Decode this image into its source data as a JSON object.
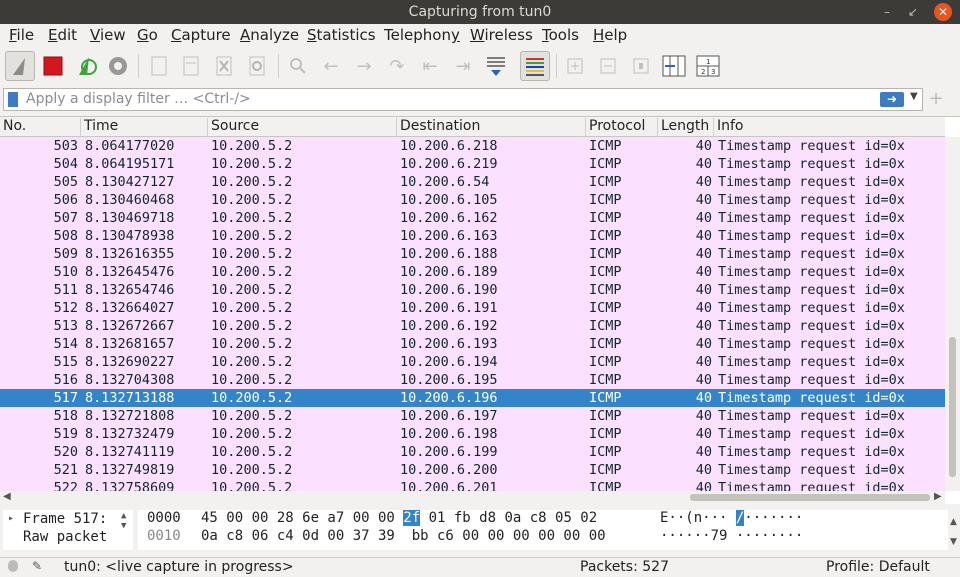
{
  "window": {
    "title": "Capturing from tun0"
  },
  "menu": [
    "File",
    "Edit",
    "View",
    "Go",
    "Capture",
    "Analyze",
    "Statistics",
    "Telephony",
    "Wireless",
    "Tools",
    "Help"
  ],
  "menu_mnemonics": [
    "F",
    "E",
    "V",
    "G",
    "C",
    "A",
    "S",
    "y",
    "W",
    "T",
    "H"
  ],
  "filter": {
    "placeholder": "Apply a display filter … <Ctrl-/>",
    "apply_icon": "arrow-right-icon"
  },
  "columns": [
    "No.",
    "Time",
    "Source",
    "Destination",
    "Protocol",
    "Length",
    "Info"
  ],
  "packets": [
    {
      "no": "503",
      "time": "8.064177020",
      "src": "10.200.5.2",
      "dst": "10.200.6.218",
      "proto": "ICMP",
      "len": "40",
      "info": "Timestamp request    id=0x"
    },
    {
      "no": "504",
      "time": "8.064195171",
      "src": "10.200.5.2",
      "dst": "10.200.6.219",
      "proto": "ICMP",
      "len": "40",
      "info": "Timestamp request    id=0x"
    },
    {
      "no": "505",
      "time": "8.130427127",
      "src": "10.200.5.2",
      "dst": "10.200.6.54",
      "proto": "ICMP",
      "len": "40",
      "info": "Timestamp request    id=0x"
    },
    {
      "no": "506",
      "time": "8.130460468",
      "src": "10.200.5.2",
      "dst": "10.200.6.105",
      "proto": "ICMP",
      "len": "40",
      "info": "Timestamp request    id=0x"
    },
    {
      "no": "507",
      "time": "8.130469718",
      "src": "10.200.5.2",
      "dst": "10.200.6.162",
      "proto": "ICMP",
      "len": "40",
      "info": "Timestamp request    id=0x"
    },
    {
      "no": "508",
      "time": "8.130478938",
      "src": "10.200.5.2",
      "dst": "10.200.6.163",
      "proto": "ICMP",
      "len": "40",
      "info": "Timestamp request    id=0x"
    },
    {
      "no": "509",
      "time": "8.132616355",
      "src": "10.200.5.2",
      "dst": "10.200.6.188",
      "proto": "ICMP",
      "len": "40",
      "info": "Timestamp request    id=0x"
    },
    {
      "no": "510",
      "time": "8.132645476",
      "src": "10.200.5.2",
      "dst": "10.200.6.189",
      "proto": "ICMP",
      "len": "40",
      "info": "Timestamp request    id=0x"
    },
    {
      "no": "511",
      "time": "8.132654746",
      "src": "10.200.5.2",
      "dst": "10.200.6.190",
      "proto": "ICMP",
      "len": "40",
      "info": "Timestamp request    id=0x"
    },
    {
      "no": "512",
      "time": "8.132664027",
      "src": "10.200.5.2",
      "dst": "10.200.6.191",
      "proto": "ICMP",
      "len": "40",
      "info": "Timestamp request    id=0x"
    },
    {
      "no": "513",
      "time": "8.132672667",
      "src": "10.200.5.2",
      "dst": "10.200.6.192",
      "proto": "ICMP",
      "len": "40",
      "info": "Timestamp request    id=0x"
    },
    {
      "no": "514",
      "time": "8.132681657",
      "src": "10.200.5.2",
      "dst": "10.200.6.193",
      "proto": "ICMP",
      "len": "40",
      "info": "Timestamp request    id=0x"
    },
    {
      "no": "515",
      "time": "8.132690227",
      "src": "10.200.5.2",
      "dst": "10.200.6.194",
      "proto": "ICMP",
      "len": "40",
      "info": "Timestamp request    id=0x"
    },
    {
      "no": "516",
      "time": "8.132704308",
      "src": "10.200.5.2",
      "dst": "10.200.6.195",
      "proto": "ICMP",
      "len": "40",
      "info": "Timestamp request    id=0x"
    },
    {
      "no": "517",
      "time": "8.132713188",
      "src": "10.200.5.2",
      "dst": "10.200.6.196",
      "proto": "ICMP",
      "len": "40",
      "info": "Timestamp request    id=0x",
      "selected": true
    },
    {
      "no": "518",
      "time": "8.132721808",
      "src": "10.200.5.2",
      "dst": "10.200.6.197",
      "proto": "ICMP",
      "len": "40",
      "info": "Timestamp request    id=0x"
    },
    {
      "no": "519",
      "time": "8.132732479",
      "src": "10.200.5.2",
      "dst": "10.200.6.198",
      "proto": "ICMP",
      "len": "40",
      "info": "Timestamp request    id=0x"
    },
    {
      "no": "520",
      "time": "8.132741119",
      "src": "10.200.5.2",
      "dst": "10.200.6.199",
      "proto": "ICMP",
      "len": "40",
      "info": "Timestamp request    id=0x"
    },
    {
      "no": "521",
      "time": "8.132749819",
      "src": "10.200.5.2",
      "dst": "10.200.6.200",
      "proto": "ICMP",
      "len": "40",
      "info": "Timestamp request    id=0x"
    },
    {
      "no": "522",
      "time": "8.132758609",
      "src": "10.200.5.2",
      "dst": "10.200.6.201",
      "proto": "ICMP",
      "len": "40",
      "info": "Timestamp request    id=0x"
    }
  ],
  "details": {
    "frame": "Frame 517:",
    "raw": "Raw packet"
  },
  "hex": {
    "rows": [
      {
        "offset": "0000",
        "pre": "45 00 00 28 6e a7 00 00 ",
        "hl": "2f",
        "post": " 01 fb d8 0a c8 05 02",
        "ascii_pre": "E··(n··· ",
        "ascii_hl": "/",
        "ascii_post": "·······"
      },
      {
        "offset": "0010",
        "pre": "0a c8 06 c4 0d 00 37 39  bb c6 00 00 00 00 00 00",
        "hl": "",
        "post": "",
        "ascii_pre": "······79 ········",
        "ascii_hl": "",
        "ascii_post": ""
      }
    ]
  },
  "status": {
    "interface": "tun0: <live capture in progress>",
    "packets": "Packets: 527",
    "profile": "Profile: Default"
  },
  "colors": {
    "row_bg": "#fce0ff",
    "selected_bg": "#3384c8",
    "title_bg": "#3c3b37",
    "close": "#e95420"
  }
}
